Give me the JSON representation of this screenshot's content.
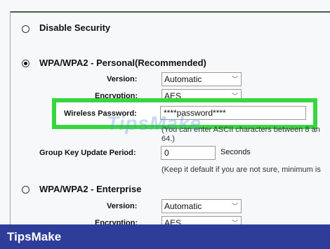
{
  "options": {
    "disable_security": {
      "label": "Disable Security"
    },
    "wpa_personal": {
      "label": "WPA/WPA2 - Personal(Recommended)",
      "version_label": "Version:",
      "version_value": "Automatic",
      "encryption_label": "Encryption:",
      "encryption_value": "AES",
      "password_label": "Wireless Password:",
      "password_value": "****password****",
      "password_hint": "(You can enter ASCII characters between 8 an",
      "password_hint_cont": "64.)",
      "group_key_label": "Group Key Update Period:",
      "group_key_value": "0",
      "group_key_unit": "Seconds",
      "group_key_hint": "(Keep it default if you are not sure, minimum is"
    },
    "wpa_enterprise": {
      "label": "WPA/WPA2 - Enterprise",
      "version_label": "Version:",
      "version_value": "Automatic",
      "encryption_label": "Encryption:",
      "encryption_value": "AES"
    }
  },
  "watermark": "TipsMake",
  "brand": "TipsMake",
  "colors": {
    "highlight": "#37d63f",
    "brand_bar": "#2f3d9a",
    "top_line": "#4b5d48"
  },
  "icons": {
    "select_arrow": "chevron-down-icon",
    "radio": "radio-button"
  }
}
